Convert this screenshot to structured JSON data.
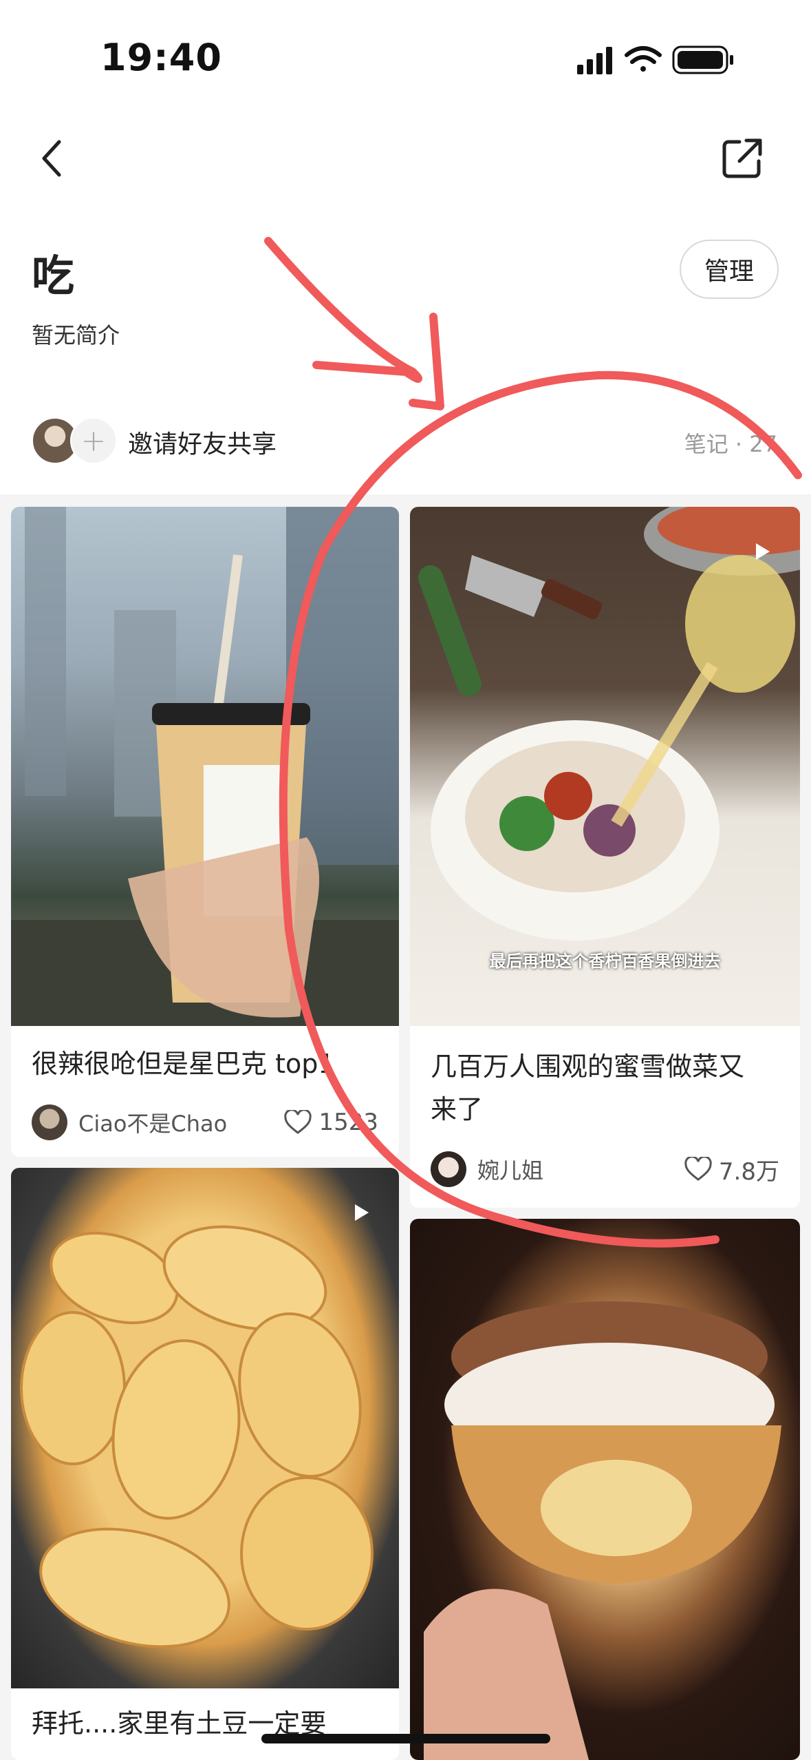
{
  "status_bar": {
    "time": "19:40"
  },
  "header": {
    "title": "吃",
    "description": "暂无简介",
    "manage_label": "管理"
  },
  "share_row": {
    "invite_label": "邀请好友共享",
    "notes_count": "笔记 · 27"
  },
  "feed": {
    "cards": [
      {
        "title": "很辣很呛但是星巴克 top1",
        "author": "Ciao不是Chao",
        "likes": "1523"
      },
      {
        "title_line1": "几百万人围观的蜜雪做菜又",
        "title_line2": "来了",
        "author": "婉儿姐",
        "likes": "7.8万",
        "caption": "最后再把这个香柠百香果倒进去"
      },
      {
        "title": "拜托....家里有土豆一定要"
      },
      {}
    ]
  },
  "colors": {
    "annotation_red": "#f05a5a",
    "feed_background": "#f4f4f4"
  }
}
